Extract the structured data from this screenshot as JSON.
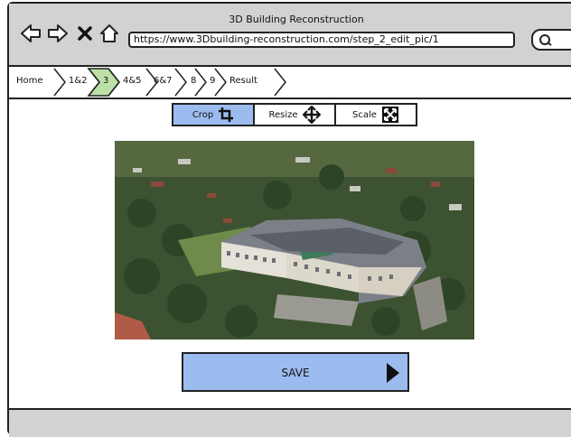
{
  "window": {
    "title": "3D Building Reconstruction",
    "url": "https://www.3Dbuilding-reconstruction.com/step_2_edit_pic/1"
  },
  "breadcrumb": {
    "items": [
      "Home",
      "1&2",
      "3",
      "4&5",
      "6&7",
      "8",
      "9",
      "Result"
    ],
    "active_index": 2,
    "active_color": "#bde0a8"
  },
  "toolbar": {
    "crop_label": "Crop",
    "resize_label": "Resize",
    "scale_label": "Scale",
    "active_tool": "Crop",
    "active_color": "#9cbcf0"
  },
  "image": {
    "subject_icon": "building-photo"
  },
  "actions": {
    "save_label": "SAVE"
  }
}
